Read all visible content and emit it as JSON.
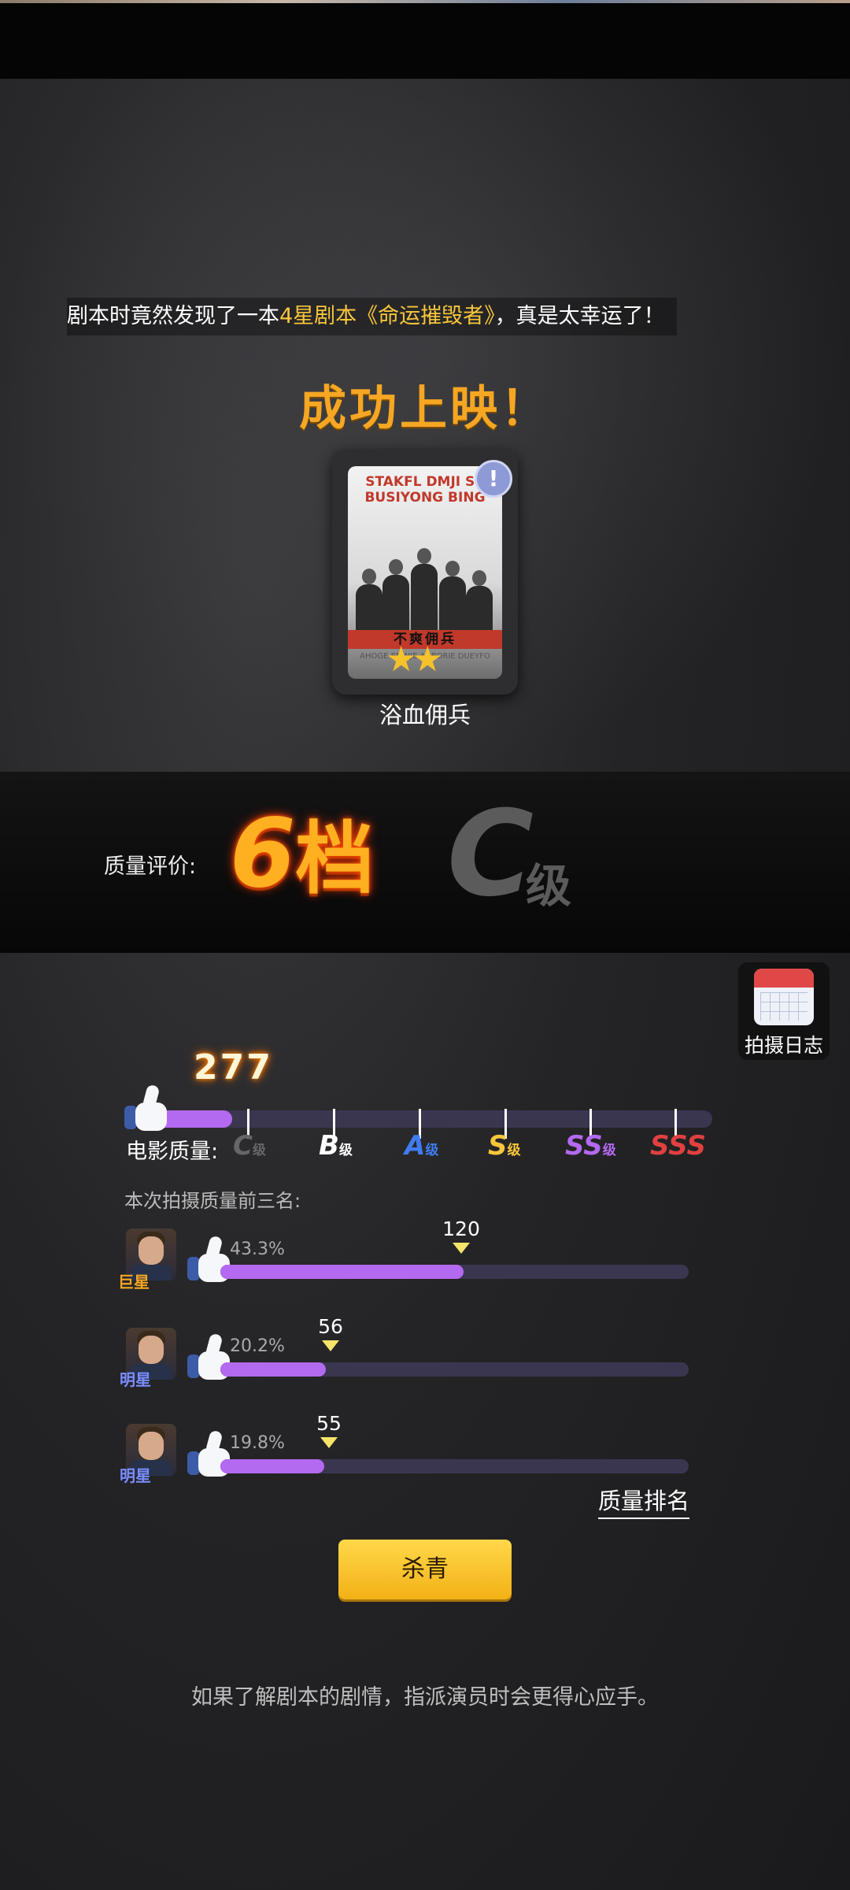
{
  "banner": {
    "prefix": "剧本时竟然发现了一本",
    "highlight": "4星剧本《命运摧毁者》",
    "suffix": "，真是太幸运了！"
  },
  "release": {
    "title": "成功上映！",
    "movie_name": "浴血佣兵",
    "poster_title": "STAKFL DMJI SC BUSIYONG BING",
    "poster_red_text": "不爽佣兵",
    "poster_foot": "AHOGE EN NJE AHBORIE DUEYFO",
    "stars": "★★",
    "info_badge": "!"
  },
  "rating": {
    "label": "质量评价:",
    "tier_num": "6",
    "tier_unit": "档",
    "grade": "C",
    "grade_unit": "级"
  },
  "log_button": {
    "label": "拍摄日志"
  },
  "quality": {
    "value": "277",
    "fill_fraction": 0.165,
    "label": "电影质量:",
    "grades": [
      {
        "letter": "C",
        "unit": "级",
        "color": "#666666"
      },
      {
        "letter": "B",
        "unit": "级",
        "color": "#ffffff"
      },
      {
        "letter": "A",
        "unit": "级",
        "color": "#3f7cf2"
      },
      {
        "letter": "S",
        "unit": "级",
        "color": "#f7c63a"
      },
      {
        "letter": "SS",
        "unit": "级",
        "color": "#b469f1"
      },
      {
        "letter": "SSS",
        "unit": "",
        "color": "#e04040"
      }
    ]
  },
  "top3": {
    "label": "本次拍摄质量前三名:",
    "items": [
      {
        "role": "巨星",
        "role_color": "#f5a623",
        "percent": "43.3%",
        "score": "120",
        "fill_fraction": 0.52
      },
      {
        "role": "明星",
        "role_color": "#7b8cff",
        "percent": "20.2%",
        "score": "56",
        "fill_fraction": 0.226
      },
      {
        "role": "明星",
        "role_color": "#7b8cff",
        "percent": "19.8%",
        "score": "55",
        "fill_fraction": 0.222
      }
    ]
  },
  "rank_link": "质量排名",
  "wrap_button": "杀青",
  "tip": "如果了解剧本的剧情，指派演员时会更得心应手。"
}
